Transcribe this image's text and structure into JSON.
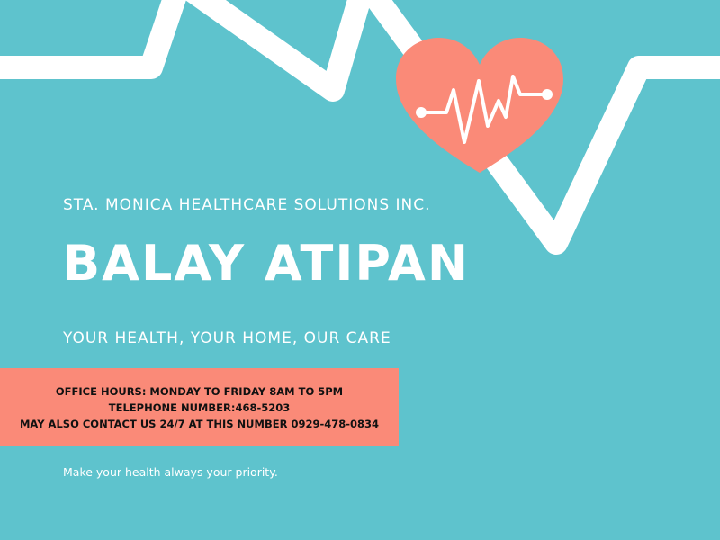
{
  "colors": {
    "background": "#5ec3cd",
    "heart": "#fa8a78",
    "contact_box": "#fa8a78",
    "text": "#ffffff",
    "contact_text": "#111111"
  },
  "company": "STA. MONICA HEALTHCARE SOLUTIONS INC.",
  "title": "BALAY ATIPAN",
  "tagline": "YOUR HEALTH, YOUR HOME, OUR CARE",
  "contact": {
    "office_hours": "OFFICE HOURS: MONDAY TO FRIDAY 8AM TO 5PM",
    "telephone": "TELEPHONE NUMBER:468-5203",
    "hotline": "MAY ALSO CONTACT US 24/7 AT THIS NUMBER 0929-478-0834"
  },
  "note": "Make your health always your priority.",
  "icons": {
    "background": "heartbeat-line-icon",
    "heart": "heart-pulse-icon"
  }
}
